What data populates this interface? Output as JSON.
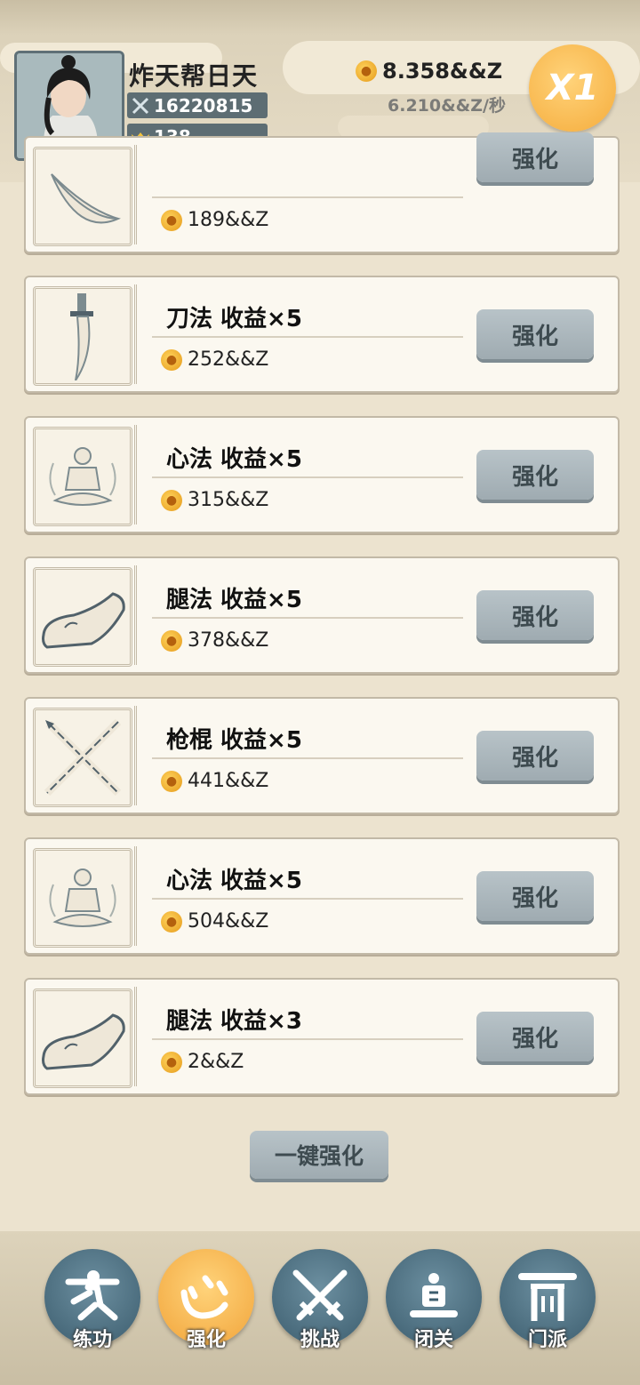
{
  "player": {
    "name": "炸天帮日天",
    "power": "16220815",
    "ingots": "138"
  },
  "currency": {
    "coins": "8.358&&Z",
    "rate": "6.210&&Z/秒",
    "multiplier": "X1"
  },
  "colors": {
    "accent": "#f5ac3c",
    "button": "#a8b4ba",
    "nav": "#3c5d6e"
  },
  "upgrades": [
    {
      "title": "",
      "cost": "189&&Z",
      "button": "强化",
      "icon": "feather-icon"
    },
    {
      "title": "刀法 收益×5",
      "cost": "252&&Z",
      "button": "强化",
      "icon": "sword-icon"
    },
    {
      "title": "心法 收益×5",
      "cost": "315&&Z",
      "button": "强化",
      "icon": "meditation-icon"
    },
    {
      "title": "腿法 收益×5",
      "cost": "378&&Z",
      "button": "强化",
      "icon": "shoe-icon"
    },
    {
      "title": "枪棍 收益×5",
      "cost": "441&&Z",
      "button": "强化",
      "icon": "crossed-staffs-icon"
    },
    {
      "title": "心法 收益×5",
      "cost": "504&&Z",
      "button": "强化",
      "icon": "meditation-icon"
    },
    {
      "title": "腿法 收益×3",
      "cost": "2&&Z",
      "button": "强化",
      "icon": "shoe-icon"
    }
  ],
  "one_key_label": "一键强化",
  "nav": [
    {
      "label": "练功",
      "icon": "kungfu-icon"
    },
    {
      "label": "强化",
      "icon": "heart-icon"
    },
    {
      "label": "挑战",
      "icon": "swords-icon"
    },
    {
      "label": "闭关",
      "icon": "retreat-icon"
    },
    {
      "label": "门派",
      "icon": "gate-icon"
    }
  ]
}
